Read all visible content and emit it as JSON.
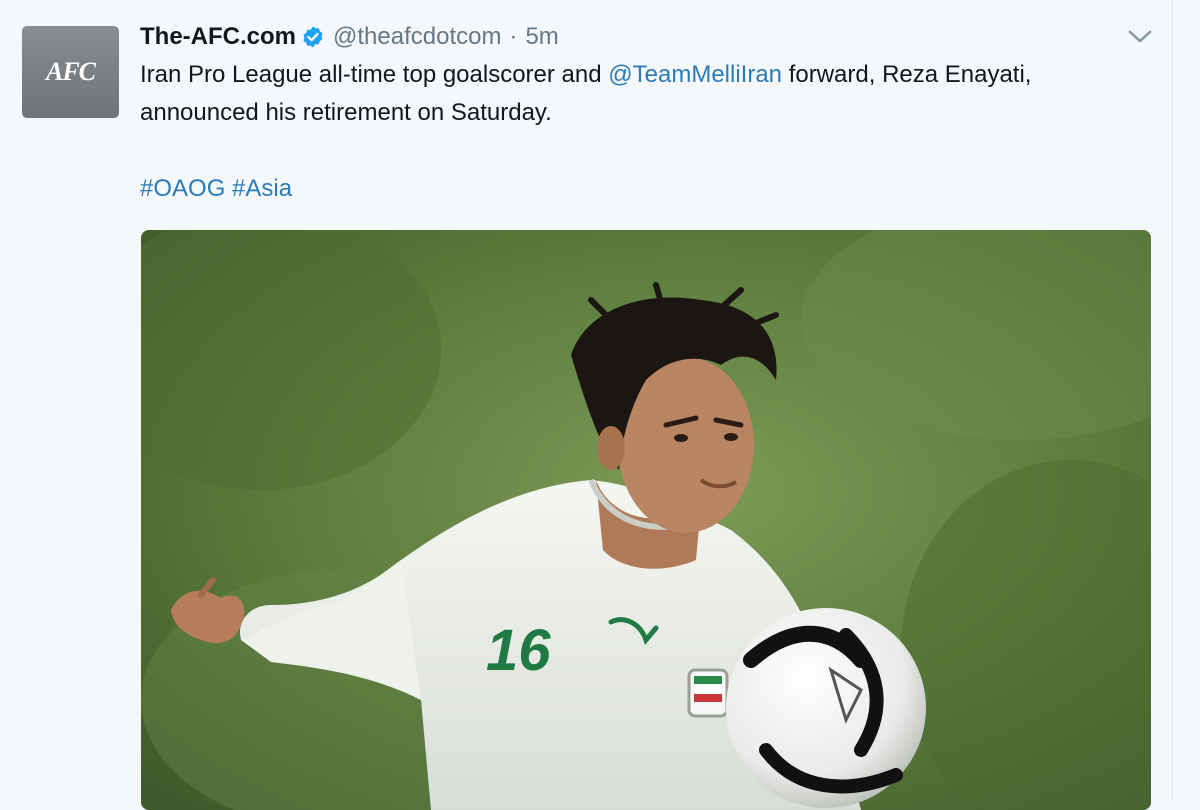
{
  "tweet": {
    "display_name": "The-AFC.com",
    "handle": "@theafcdotcom",
    "separator": "·",
    "time": "5m",
    "avatar_logo_text": "AFC",
    "text_part1": "Iran Pro League all-time top goalscorer and ",
    "mention": "@TeamMelliIran",
    "text_part2": " forward, Reza Enayati, announced his retirement on Saturday.",
    "hashtags": [
      "#OAOG",
      "#Asia"
    ],
    "jersey_number": "16"
  },
  "colors": {
    "link": "#2b7bb9",
    "name": "#14171a",
    "secondary": "#657786",
    "verified": "#1da1f2",
    "background": "#f5f8fa"
  },
  "icons": {
    "verified": "verified-badge-icon",
    "caret": "chevron-down-icon"
  }
}
